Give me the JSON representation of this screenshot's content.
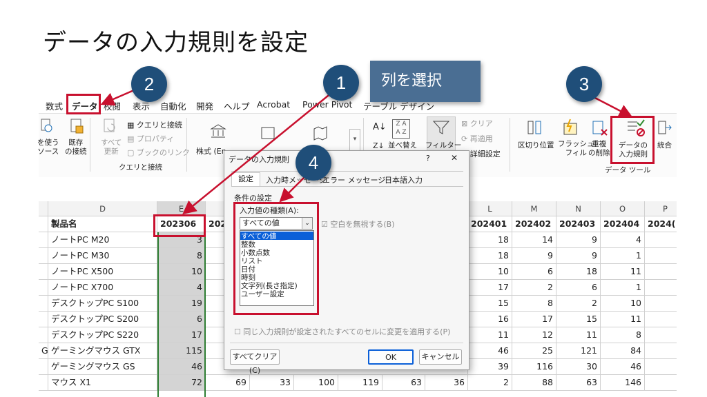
{
  "title": "データの入力規則を設定",
  "callout": "列を選択",
  "steps": [
    "1",
    "2",
    "3",
    "4"
  ],
  "tabs": [
    "数式",
    "データ",
    "校閲",
    "表示",
    "自動化",
    "開発",
    "ヘルプ",
    "Acrobat",
    "Power Pivot",
    "テーブル デザイン"
  ],
  "ribbon": {
    "get_data": "を使う\nソース",
    "existing": "既存\nの接続",
    "refresh": "すべて\n更新",
    "queries": "クエリと接続",
    "properties": "プロパティ",
    "links": "ブックのリンク",
    "group_queries": "クエリと接続",
    "stocks": "株式 (En...",
    "sort_az": "並べ替え",
    "filter": "フィルター",
    "clear": "クリア",
    "reapply": "再適用",
    "advanced": "詳細設定",
    "text_to_columns": "区切り位置",
    "flash_fill": "フラッシュ\nフィル",
    "remove_dup": "重複\nの削除",
    "data_validation": "データの\n入力規則",
    "consolidate": "統合",
    "group_tools": "データ ツール"
  },
  "grid": {
    "col_letters": [
      "D",
      "E",
      "",
      "",
      "",
      "",
      "",
      "",
      "L",
      "M",
      "N",
      "O",
      "P"
    ],
    "header_row": [
      "製品名",
      "202306",
      "2023",
      "",
      "",
      "",
      "",
      "",
      "202401",
      "202402",
      "202403",
      "202404",
      "2024("
    ],
    "rows": [
      {
        "a": "",
        "name": "ノートPC M20",
        "e": "3",
        "l": "18",
        "m": "14",
        "n": "9",
        "o": "4"
      },
      {
        "a": "",
        "name": "ノートPC M30",
        "e": "8",
        "l": "18",
        "m": "9",
        "n": "9",
        "o": "1"
      },
      {
        "a": "",
        "name": "ノートPC X500",
        "e": "10",
        "l": "10",
        "m": "6",
        "n": "18",
        "o": "11"
      },
      {
        "a": "",
        "name": "ノートPC X700",
        "e": "4",
        "l": "17",
        "m": "2",
        "n": "6",
        "o": "1"
      },
      {
        "a": "",
        "name": "デスクトップPC S100",
        "e": "19",
        "l": "15",
        "m": "8",
        "n": "2",
        "o": "10"
      },
      {
        "a": "",
        "name": "デスクトップPC S200",
        "e": "6",
        "l": "16",
        "m": "17",
        "n": "15",
        "o": "11"
      },
      {
        "a": "",
        "name": "デスクトップPC S220",
        "e": "17",
        "l": "11",
        "m": "12",
        "n": "11",
        "o": "8"
      },
      {
        "a": "G",
        "name": "ゲーミングマウス GTX",
        "e": "115",
        "l": "46",
        "m": "25",
        "n": "121",
        "o": "84"
      },
      {
        "a": "",
        "name": "ゲーミングマウス GS",
        "e": "46",
        "l": "39",
        "m": "116",
        "n": "30",
        "o": "46"
      },
      {
        "a": "",
        "name": "マウス X1",
        "e": "72",
        "l": "2",
        "m": "88",
        "n": "63",
        "o": "146"
      }
    ],
    "last_row_mid": [
      "69",
      "33",
      "100",
      "119",
      "63",
      "36"
    ]
  },
  "dialog": {
    "title": "データの入力規則",
    "help": "?",
    "close": "✕",
    "tabs": [
      "設定",
      "入力時メッセージ",
      "エラー メッセージ",
      "日本語入力"
    ],
    "section": "条件の設定",
    "allow_label": "入力値の種類(A):",
    "allow_value": "すべての値",
    "ignore_blank": "空白を無視する(B)",
    "options": [
      "すべての値",
      "整数",
      "小数点数",
      "リスト",
      "日付",
      "時刻",
      "文字列(長さ指定)",
      "ユーザー設定"
    ],
    "apply_all": "同じ入力規則が設定されたすべてのセルに変更を適用する(P)",
    "clear_all": "すべてクリア(C)",
    "ok": "OK",
    "cancel": "キャンセル"
  }
}
